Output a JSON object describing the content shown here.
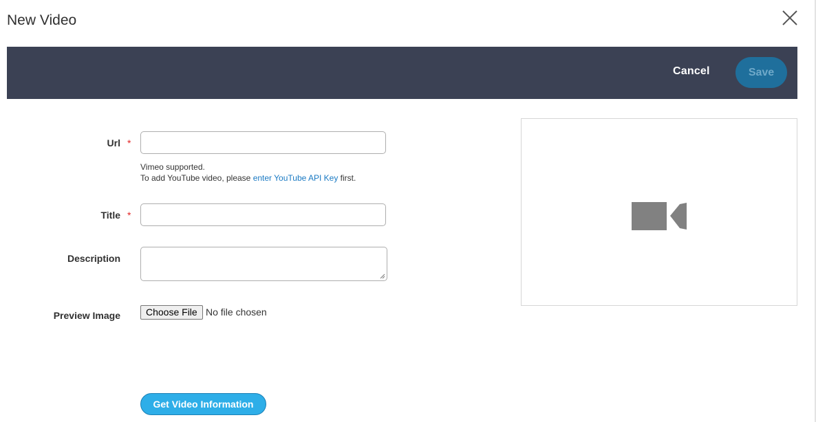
{
  "modal": {
    "title": "New Video"
  },
  "toolbar": {
    "cancel_label": "Cancel",
    "save_label": "Save"
  },
  "form": {
    "url": {
      "label": "Url",
      "required_mark": "*",
      "value": "",
      "note_line1": "Vimeo supported.",
      "note_line2_prefix": "To add YouTube video, please ",
      "note_link": "enter YouTube API Key",
      "note_line2_suffix": " first."
    },
    "title": {
      "label": "Title",
      "required_mark": "*",
      "value": ""
    },
    "description": {
      "label": "Description",
      "value": ""
    },
    "preview_image": {
      "label": "Preview Image",
      "button_label": "Choose File",
      "status": "No file chosen"
    },
    "get_info_label": "Get Video Information"
  },
  "preview": {
    "icon": "video-camera-icon"
  },
  "colors": {
    "toolbar_bg": "#3b4154",
    "save_bg": "#1f6f9c",
    "accent": "#2eaee8",
    "link": "#1979c3",
    "required": "#e22626"
  }
}
